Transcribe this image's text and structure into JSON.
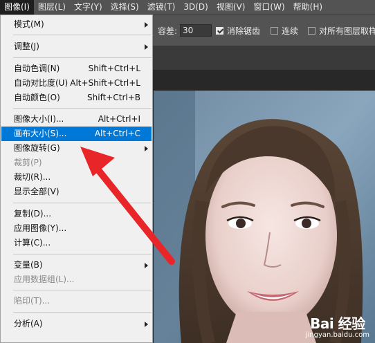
{
  "menubar": {
    "items": [
      {
        "label": "图像(I)",
        "active": true
      },
      {
        "label": "图层(L)"
      },
      {
        "label": "文字(Y)"
      },
      {
        "label": "选择(S)"
      },
      {
        "label": "滤镜(T)"
      },
      {
        "label": "3D(D)"
      },
      {
        "label": "视图(V)"
      },
      {
        "label": "窗口(W)"
      },
      {
        "label": "帮助(H)"
      }
    ]
  },
  "options": {
    "tolerance_label": "容差:",
    "tolerance_value": "30",
    "antialias_label": "消除锯齿",
    "antialias_checked": true,
    "contiguous_label": "连续",
    "contiguous_checked": false,
    "all_layers_label": "对所有图层取样",
    "all_layers_checked": false
  },
  "image_menu": {
    "items": [
      {
        "label": "模式(M)",
        "submenu": true
      },
      {
        "label": "调整(J)",
        "submenu": true
      },
      {
        "label": "自动色调(N)",
        "shortcut": "Shift+Ctrl+L"
      },
      {
        "label": "自动对比度(U)",
        "shortcut": "Alt+Shift+Ctrl+L"
      },
      {
        "label": "自动颜色(O)",
        "shortcut": "Shift+Ctrl+B"
      },
      {
        "label": "图像大小(I)...",
        "shortcut": "Alt+Ctrl+I"
      },
      {
        "label": "画布大小(S)...",
        "shortcut": "Alt+Ctrl+C",
        "selected": true
      },
      {
        "label": "图像旋转(G)",
        "submenu": true
      },
      {
        "label": "裁剪(P)",
        "disabled": true
      },
      {
        "label": "裁切(R)..."
      },
      {
        "label": "显示全部(V)"
      },
      {
        "label": "复制(D)..."
      },
      {
        "label": "应用图像(Y)..."
      },
      {
        "label": "计算(C)..."
      },
      {
        "label": "变量(B)",
        "submenu": true
      },
      {
        "label": "应用数据组(L)...",
        "disabled": true
      },
      {
        "label": "陷印(T)...",
        "disabled": true
      },
      {
        "label": "分析(A)",
        "submenu": true
      }
    ]
  },
  "watermark": {
    "main": "Bai 经验",
    "sub": "jingyan.baidu.com"
  },
  "colors": {
    "highlight": "#0078d7",
    "annotation_arrow": "#e8262a",
    "menubar_bg": "#535353"
  },
  "icons": {
    "submenu": "chevron-right-icon",
    "annotation": "red-arrow-icon"
  }
}
